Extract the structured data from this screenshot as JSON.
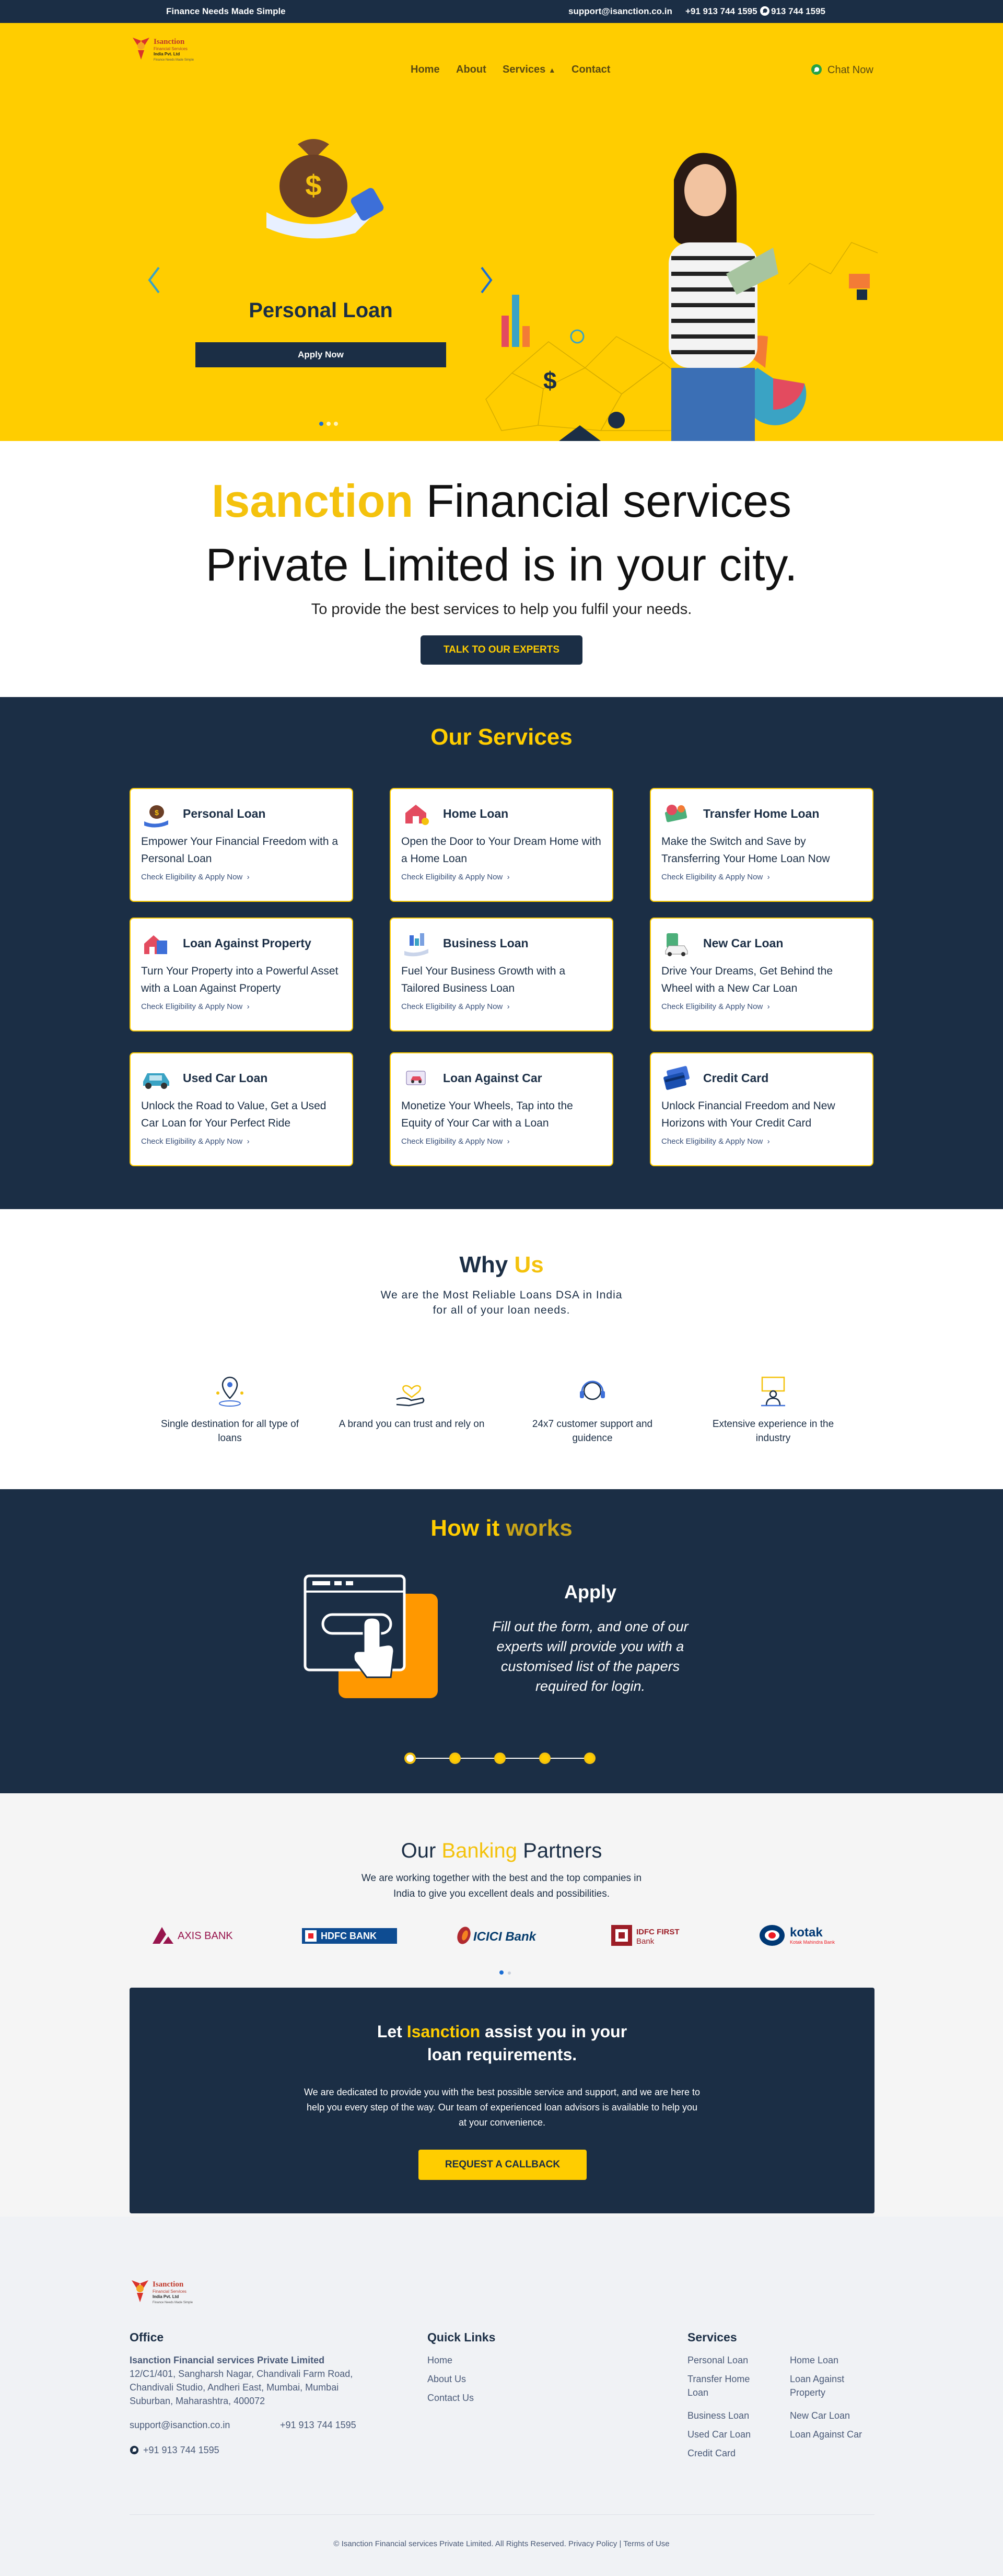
{
  "topbar": {
    "tagline": "Finance Needs Made Simple",
    "email": "support@isanction.co.in",
    "phone1": "+91 913 744 1595",
    "phone2": "913 744 1595"
  },
  "nav": {
    "home": "Home",
    "about": "About",
    "services": "Services",
    "contact": "Contact",
    "chat": "Chat Now"
  },
  "hero": {
    "slide_title": "Personal Loan",
    "apply_label": "Apply Now",
    "slide_count": 3,
    "active_slide": 1
  },
  "intro": {
    "brand": "Isanction",
    "heading_rest": "Financial services",
    "heading_line2": "Private Limited is in your city.",
    "subtitle": "To provide the best services to help you fulfil your needs.",
    "cta_label": "TALK TO OUR EXPERTS"
  },
  "services": {
    "title": "Our Services",
    "link_label": "Check Eligibility & Apply Now",
    "items": [
      {
        "title": "Personal Loan",
        "desc": "Empower Your Financial Freedom with a Personal Loan",
        "icon": "money-bag-hand-icon"
      },
      {
        "title": "Home Loan",
        "desc": "Open the Door to Your Dream Home with a Home Loan",
        "icon": "house-key-icon"
      },
      {
        "title": "Transfer Home Loan",
        "desc": "Make the Switch and Save by Transferring Your Home Loan Now",
        "icon": "money-transfer-icon"
      },
      {
        "title": "Loan Against Property",
        "desc": "Turn Your Property into a Powerful Asset with a Loan Against Property",
        "icon": "property-icon"
      },
      {
        "title": "Business Loan",
        "desc": "Fuel Your Business Growth with a Tailored Business Loan",
        "icon": "business-hand-icon"
      },
      {
        "title": "New Car Loan",
        "desc": "Drive Your Dreams, Get Behind the Wheel with a New Car Loan",
        "icon": "new-car-icon"
      },
      {
        "title": "Used Car Loan",
        "desc": "Unlock the Road to Value, Get a Used Car Loan for Your Perfect Ride",
        "icon": "used-car-icon"
      },
      {
        "title": "Loan Against Car",
        "desc": "Monetize Your Wheels, Tap into the Equity of Your Car with a Loan",
        "icon": "car-money-icon"
      },
      {
        "title": "Credit Card",
        "desc": "Unlock Financial Freedom and New Horizons with Your Credit Card",
        "icon": "credit-card-icon"
      }
    ]
  },
  "why": {
    "title_a": "Why",
    "title_b": "Us",
    "subtitle": "We are the Most Reliable Loans DSA in India for all of your loan needs.",
    "features": [
      {
        "label": "Single destination for all type of loans",
        "icon": "location-pin-icon"
      },
      {
        "label": "A brand you can trust and rely on",
        "icon": "heart-hand-icon"
      },
      {
        "label": "24x7 customer support and guidence",
        "icon": "headset-icon"
      },
      {
        "label": "Extensive experience in the industry",
        "icon": "presenter-icon"
      }
    ]
  },
  "how": {
    "title_a": "How it",
    "title_b": "works",
    "step_title": "Apply",
    "step_desc": "Fill out the form, and one of our experts will provide you with a customised list of the papers required for login.",
    "step_count": 5,
    "active_step": 1
  },
  "partners": {
    "title_a": "Our",
    "title_b": "Banking",
    "title_c": "Partners",
    "subtitle": "We are working together with the best and the top companies in India to give you excellent deals and possibilities.",
    "banks": [
      "AXIS BANK",
      "HDFC BANK",
      "ICICI Bank",
      "IDFC FIRST Bank",
      "kotak"
    ]
  },
  "cta": {
    "title_a": "Let",
    "title_brand": "Isanction",
    "title_b": "assist you in your",
    "title_line2": "loan requirements.",
    "desc": "We are dedicated to provide you with the best possible service and support, and we are here to help you every step of the way. Our team of experienced loan advisors is available to help you at your convenience.",
    "button": "REQUEST A CALLBACK"
  },
  "footer": {
    "office_title": "Office",
    "company": "Isanction Financial services Private Limited",
    "address": "12/C1/401, Sangharsh Nagar, Chandivali Farm Road, Chandivali Studio, Andheri East, Mumbai, Mumbai Suburban, Maharashtra, 400072",
    "email": "support@isanction.co.in",
    "phone": "+91 913 744 1595",
    "whatsapp": "+91 913 744 1595",
    "quick_title": "Quick Links",
    "quick": [
      "Home",
      "About Us",
      "Contact Us"
    ],
    "services_title": "Services",
    "services_col1": [
      "Personal Loan",
      "Transfer Home Loan",
      "Business Loan",
      "Used Car Loan",
      "Credit Card"
    ],
    "services_col2": [
      "Home Loan",
      "Loan Against Property",
      "New Car Loan",
      "Loan Against Car"
    ],
    "copyright": "© Isanction Financial services Private Limited. All Rights Reserved.",
    "privacy": "Privacy Policy",
    "sep": "|",
    "terms": "Terms of Use"
  },
  "logo": {
    "line1": "Isanction",
    "line2": "Financial Services",
    "line3": "India Pvt. Ltd",
    "tagline": "Finance Needs Made Simple"
  },
  "colors": {
    "navy": "#1b2e45",
    "yellow": "#ffcd00",
    "gold": "#f4c20d"
  }
}
